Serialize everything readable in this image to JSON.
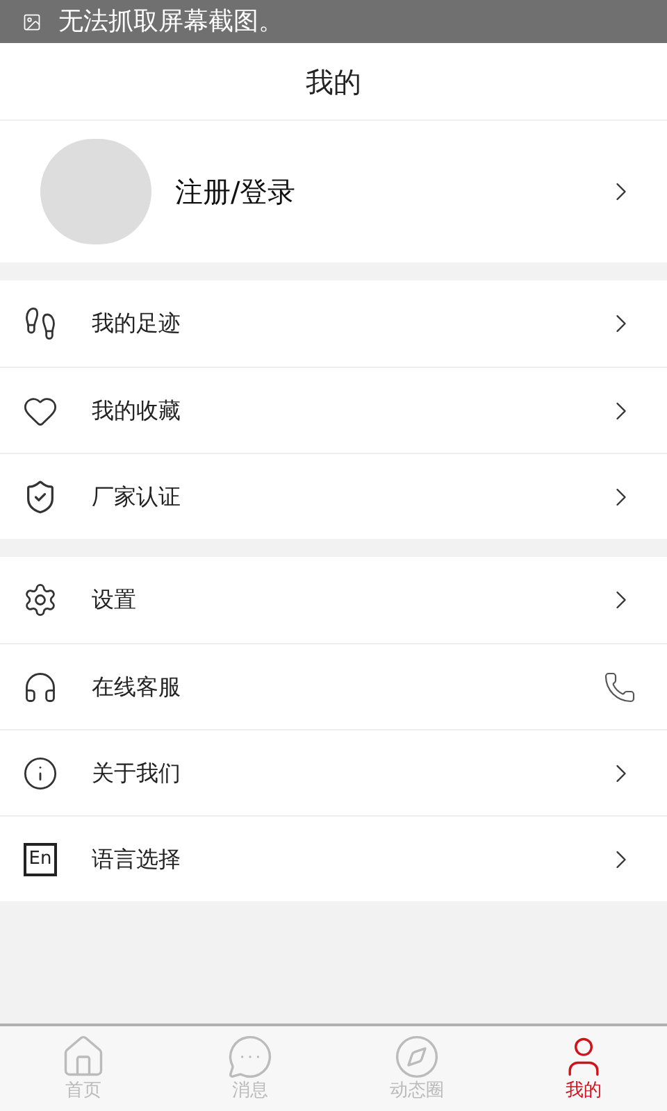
{
  "toast": {
    "text": "无法抓取屏幕截图。"
  },
  "header": {
    "title": "我的"
  },
  "profile": {
    "label": "注册/登录"
  },
  "groups": [
    [
      {
        "kind": "link",
        "label": "我的足迹"
      },
      {
        "kind": "link",
        "label": "我的收藏"
      },
      {
        "kind": "link",
        "label": "厂家认证"
      }
    ],
    [
      {
        "kind": "link",
        "label": "设置"
      },
      {
        "kind": "call",
        "label": "在线客服"
      },
      {
        "kind": "link",
        "label": "关于我们"
      },
      {
        "kind": "link",
        "badge": "En",
        "label": "语言选择"
      }
    ]
  ],
  "tabs": [
    {
      "label": "首页",
      "selected": false
    },
    {
      "label": "消息",
      "selected": false
    },
    {
      "label": "动态圈",
      "selected": false
    },
    {
      "label": "我的",
      "selected": true
    }
  ]
}
